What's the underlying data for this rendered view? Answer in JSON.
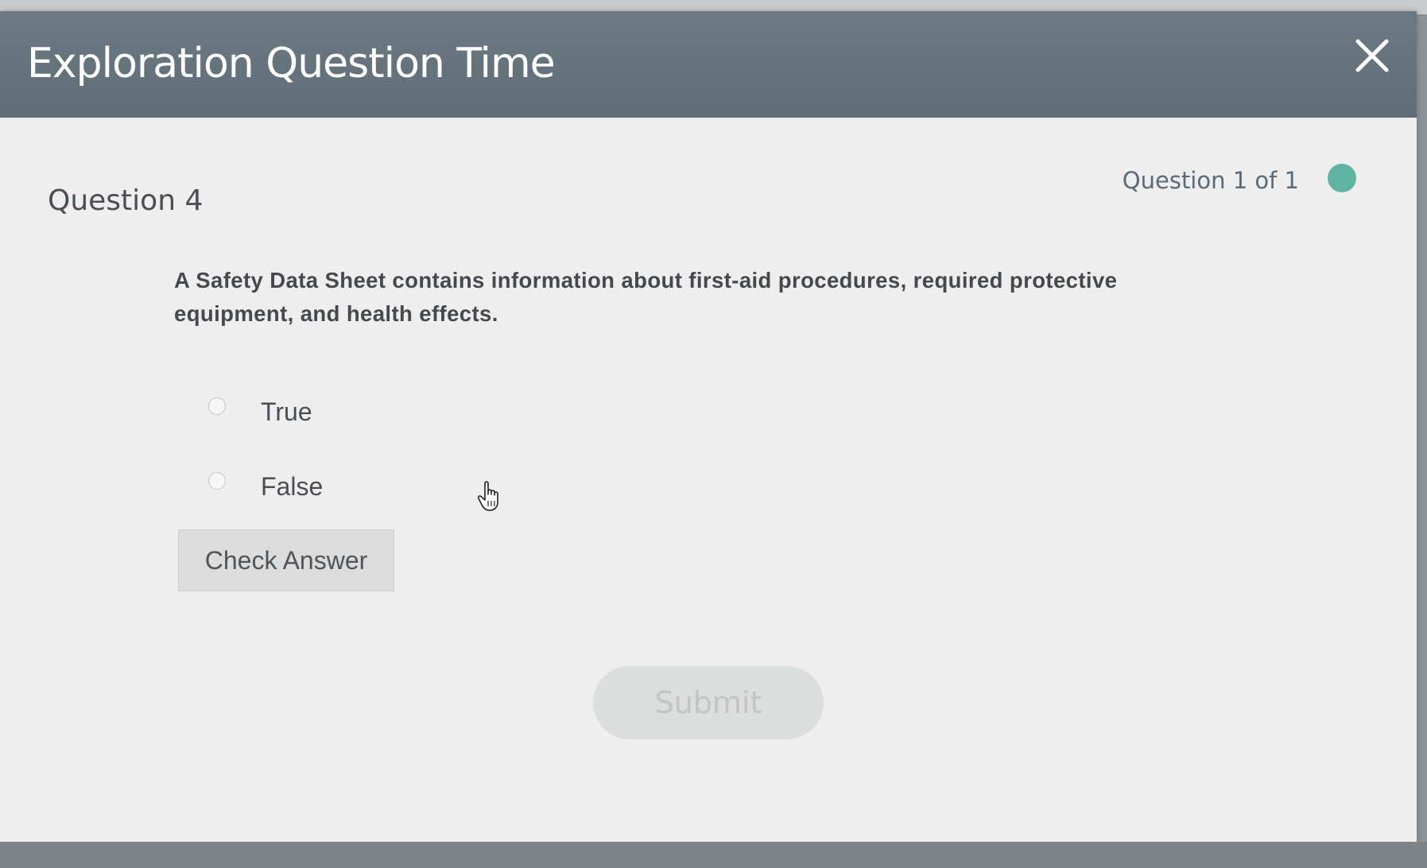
{
  "modal": {
    "title": "Exploration Question Time",
    "close_icon": "close-icon"
  },
  "question": {
    "heading": "Question 4",
    "counter": "Question 1 of 1",
    "status_color": "#5fb3a3",
    "text": "A Safety Data Sheet contains information about first-aid procedures, required protective equipment, and health effects."
  },
  "options": [
    {
      "label": "True",
      "selected": false
    },
    {
      "label": "False",
      "selected": false
    }
  ],
  "buttons": {
    "check_answer": "Check Answer",
    "submit": "Submit"
  },
  "colors": {
    "header": "#65737d",
    "accent": "#5fb3a3",
    "body": "#eeeeee"
  }
}
